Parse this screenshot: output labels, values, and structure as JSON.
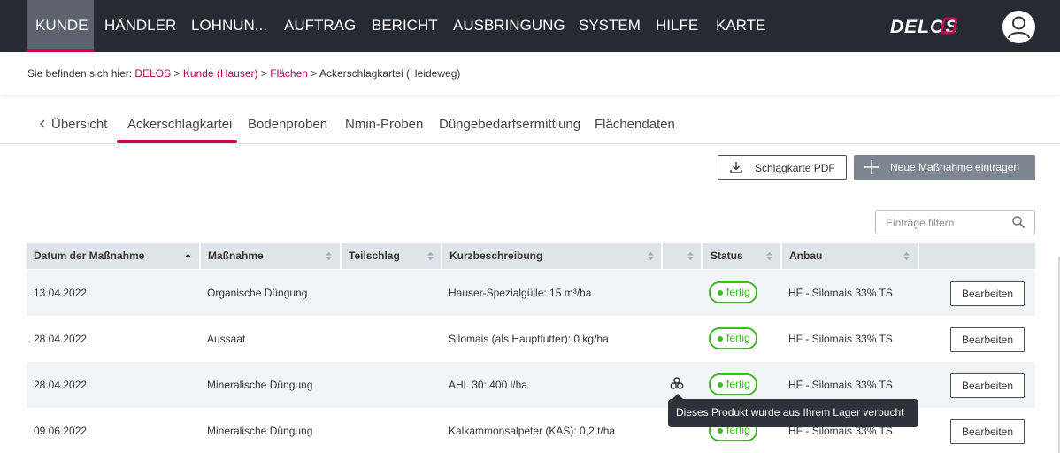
{
  "nav": {
    "items": [
      "KUNDE",
      "HÄNDLER",
      "LOHNUN...",
      "AUFTRAG",
      "BERICHT",
      "AUSBRINGUNG",
      "SYSTEM",
      "HILFE",
      "KARTE"
    ],
    "active": "KUNDE",
    "accent": "#c8064f",
    "background": "#252a33"
  },
  "logo": {
    "text": "DELOS"
  },
  "breadcrumb": {
    "prefix": "Sie befinden sich hier:",
    "links": [
      "DELOS",
      "Kunde (Hauser)",
      "Flächen"
    ],
    "current": "Ackerschlagkartei (Heideweg)",
    "separator": ">"
  },
  "tabs": {
    "back_label": "Übersicht",
    "items": [
      "Ackerschlagkartei",
      "Bodenproben",
      "Nmin-Proben",
      "Düngebedarfsermittlung",
      "Flächendaten"
    ],
    "active": "Ackerschlagkartei"
  },
  "actions": {
    "pdf_label": "Schlagkarte PDF",
    "new_label": "Neue Maßnahme eintragen"
  },
  "filter": {
    "placeholder": "Einträge filtern",
    "value": ""
  },
  "table": {
    "columns": [
      "Datum der Maßnahme",
      "Maßnahme",
      "Teilschlag",
      "Kurzbeschreibung",
      "",
      "Status",
      "Anbau",
      ""
    ],
    "sorted_column": "Datum der Maßnahme",
    "sort_direction": "ascending",
    "rows": [
      {
        "date": "13.04.2022",
        "measure": "Organische Düngung",
        "subfield": "",
        "description": "Hauser-Spezialgülle: 15 m³/ha",
        "stock": false,
        "status": "fertig",
        "crop": "HF - Silomais 33% TS",
        "action": "Bearbeiten"
      },
      {
        "date": "28.04.2022",
        "measure": "Aussaat",
        "subfield": "",
        "description": "Silomais (als Hauptfutter): 0 kg/ha",
        "stock": false,
        "status": "fertig",
        "crop": "HF - Silomais 33% TS",
        "action": "Bearbeiten"
      },
      {
        "date": "28.04.2022",
        "measure": "Mineralische Düngung",
        "subfield": "",
        "description": "AHL 30: 400 l/ha",
        "stock": true,
        "status": "fertig",
        "crop": "HF - Silomais 33% TS",
        "action": "Bearbeiten"
      },
      {
        "date": "09.06.2022",
        "measure": "Mineralische Düngung",
        "subfield": "",
        "description": "Kalkammonsalpeter (KAS): 0,2 t/ha",
        "stock": false,
        "status": "fertig",
        "crop": "HF - Silomais 33% TS",
        "action": "Bearbeiten"
      }
    ],
    "status_color": "#45b52c"
  },
  "tooltip": {
    "text": "Dieses Produkt wurde aus Ihrem Lager verbucht"
  }
}
